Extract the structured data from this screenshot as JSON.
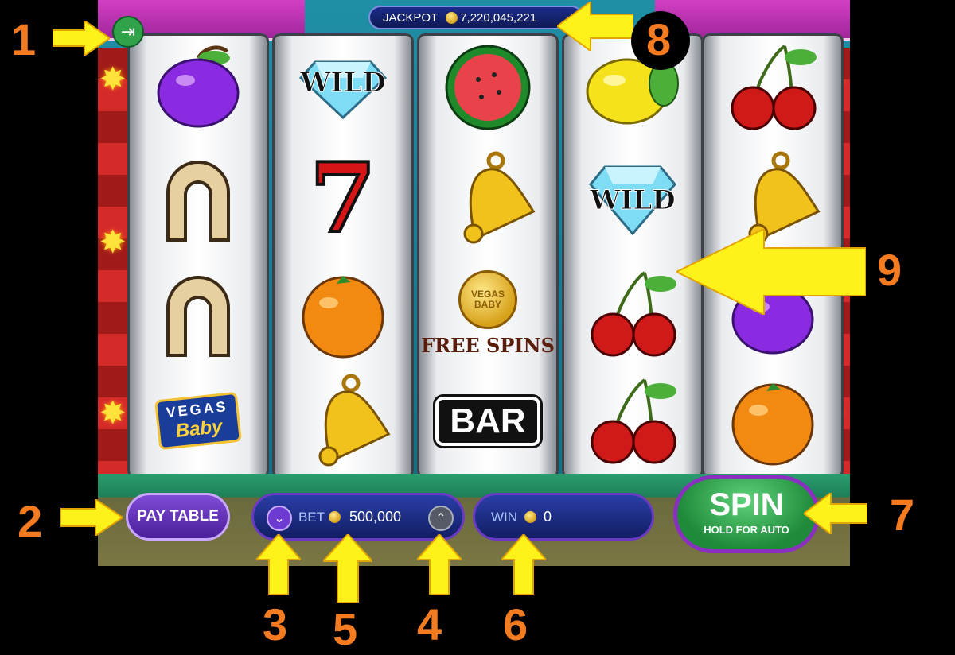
{
  "jackpot": {
    "label": "JACKPOT",
    "amount": "7,220,045,221"
  },
  "reels": [
    [
      "plum",
      "horseshoe",
      "horseshoe",
      "vegas-baby-logo"
    ],
    [
      "wild-diamond",
      "seven",
      "orange",
      "bell"
    ],
    [
      "watermelon",
      "bell",
      "free-spins-coin",
      "bar"
    ],
    [
      "lemon",
      "wild-diamond",
      "cherries",
      "cherries"
    ],
    [
      "cherries",
      "bell",
      "plum",
      "orange"
    ]
  ],
  "symbols": {
    "wild_text": "WILD",
    "seven_text": "7",
    "bar_text": "BAR",
    "free_spins_coin_text": "VEGAS BABY",
    "free_spins_text": "FREE SPINS",
    "logo_line1": "VEGAS",
    "logo_line2": "Baby"
  },
  "controls": {
    "pay_table": "PAY TABLE",
    "bet_label": "BET",
    "bet_value": "500,000",
    "win_label": "WIN",
    "win_value": "0",
    "spin_label": "SPIN",
    "spin_sub": "HOLD FOR AUTO"
  },
  "callouts": [
    "1",
    "2",
    "3",
    "4",
    "5",
    "6",
    "7",
    "8",
    "9"
  ],
  "colors": {
    "callout": "#f47b20",
    "arrow": "#fff21a"
  }
}
